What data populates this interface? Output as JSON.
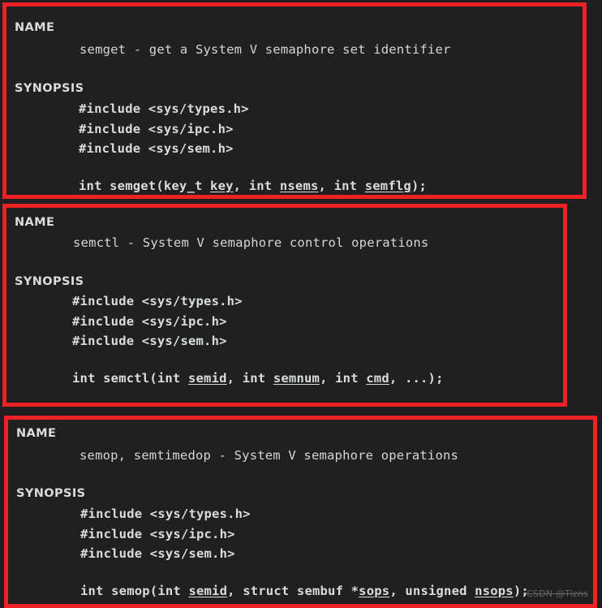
{
  "page": {
    "background_color": "#1f1f1f",
    "panel_background_color": "#202020",
    "highlight_color": "#ee2226",
    "text_color": "#d3d7d8",
    "watermark": "CSDN @Tizns"
  },
  "panels": [
    {
      "id": "semget",
      "name_heading": "NAME",
      "name_body": "semget - get a System V semaphore set identifier",
      "synopsis_heading": "SYNOPSIS",
      "includes": [
        "#include <sys/types.h>",
        "#include <sys/ipc.h>",
        "#include <sys/sem.h>"
      ],
      "signature": {
        "full_text": "int semget(key_t key, int nsems, int semflg);",
        "parts": [
          {
            "text": "int semget(key_t ",
            "underline": false
          },
          {
            "text": "key",
            "underline": true
          },
          {
            "text": ", int ",
            "underline": false
          },
          {
            "text": "nsems",
            "underline": true
          },
          {
            "text": ", int ",
            "underline": false
          },
          {
            "text": "semflg",
            "underline": true
          },
          {
            "text": ");",
            "underline": false
          }
        ]
      }
    },
    {
      "id": "semctl",
      "name_heading": "NAME",
      "name_body": "semctl - System V semaphore control operations",
      "synopsis_heading": "SYNOPSIS",
      "includes": [
        "#include <sys/types.h>",
        "#include <sys/ipc.h>",
        "#include <sys/sem.h>"
      ],
      "signature": {
        "full_text": "int semctl(int semid, int semnum, int cmd, ...);",
        "parts": [
          {
            "text": "int semctl(int ",
            "underline": false
          },
          {
            "text": "semid",
            "underline": true
          },
          {
            "text": ", int ",
            "underline": false
          },
          {
            "text": "semnum",
            "underline": true
          },
          {
            "text": ", int ",
            "underline": false
          },
          {
            "text": "cmd",
            "underline": true
          },
          {
            "text": ", ...);",
            "underline": false
          }
        ]
      }
    },
    {
      "id": "semop",
      "name_heading": "NAME",
      "name_body": "semop, semtimedop - System V semaphore operations",
      "synopsis_heading": "SYNOPSIS",
      "includes": [
        "#include <sys/types.h>",
        "#include <sys/ipc.h>",
        "#include <sys/sem.h>"
      ],
      "signature": {
        "full_text": "int semop(int semid, struct sembuf *sops, unsigned nsops);",
        "parts": [
          {
            "text": "int semop(int ",
            "underline": false
          },
          {
            "text": "semid",
            "underline": true
          },
          {
            "text": ", struct sembuf *",
            "underline": false
          },
          {
            "text": "sops",
            "underline": true
          },
          {
            "text": ", unsigned ",
            "underline": false
          },
          {
            "text": "nsops",
            "underline": true
          },
          {
            "text": ");",
            "underline": false
          }
        ]
      }
    }
  ]
}
